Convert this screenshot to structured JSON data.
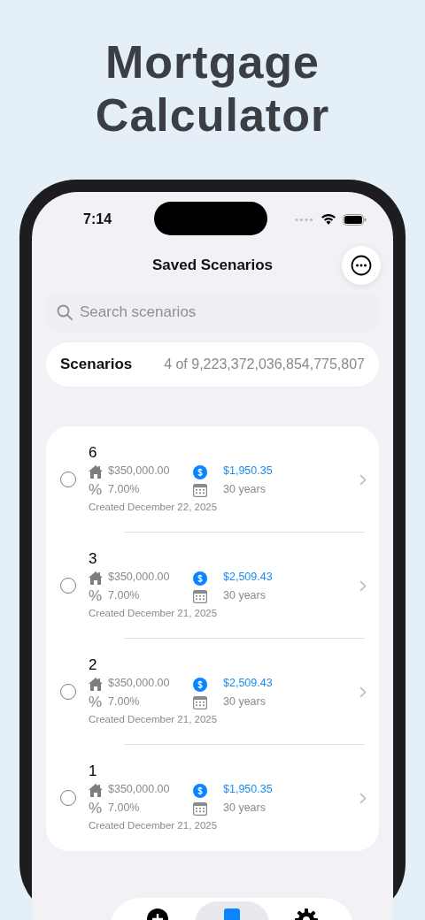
{
  "headline": "Mortgage Calculator",
  "status_bar": {
    "time": "7:14"
  },
  "nav": {
    "title": "Saved Scenarios"
  },
  "search": {
    "placeholder": "Search scenarios"
  },
  "summary": {
    "label": "Scenarios",
    "count": "4 of 9,223,372,036,854,775,807"
  },
  "scenarios": [
    {
      "name": "6",
      "selected": false,
      "amount": "$350,000.00",
      "payment": "$1,950.35",
      "rate_symbol": "%",
      "rate": "7.00%",
      "term": "30 years",
      "created": "Created December 22, 2025"
    },
    {
      "name": "3",
      "selected": false,
      "amount": "$350,000.00",
      "payment": "$2,509.43",
      "rate_symbol": "%",
      "rate": "7.00%",
      "term": "30 years",
      "created": "Created December 21, 2025"
    },
    {
      "name": "2",
      "selected": false,
      "amount": "$350,000.00",
      "payment": "$2,509.43",
      "rate_symbol": "%",
      "rate": "7.00%",
      "term": "30 years",
      "created": "Created December 21, 2025"
    },
    {
      "name": "1",
      "selected": false,
      "amount": "$350,000.00",
      "payment": "$1,950.35",
      "rate_symbol": "%",
      "rate": "7.00%",
      "term": "30 years",
      "created": "Created December 21, 2025"
    }
  ],
  "tabs": [
    {
      "kind": "add",
      "selected": false
    },
    {
      "kind": "list",
      "selected": true
    },
    {
      "kind": "settings",
      "selected": false
    }
  ]
}
